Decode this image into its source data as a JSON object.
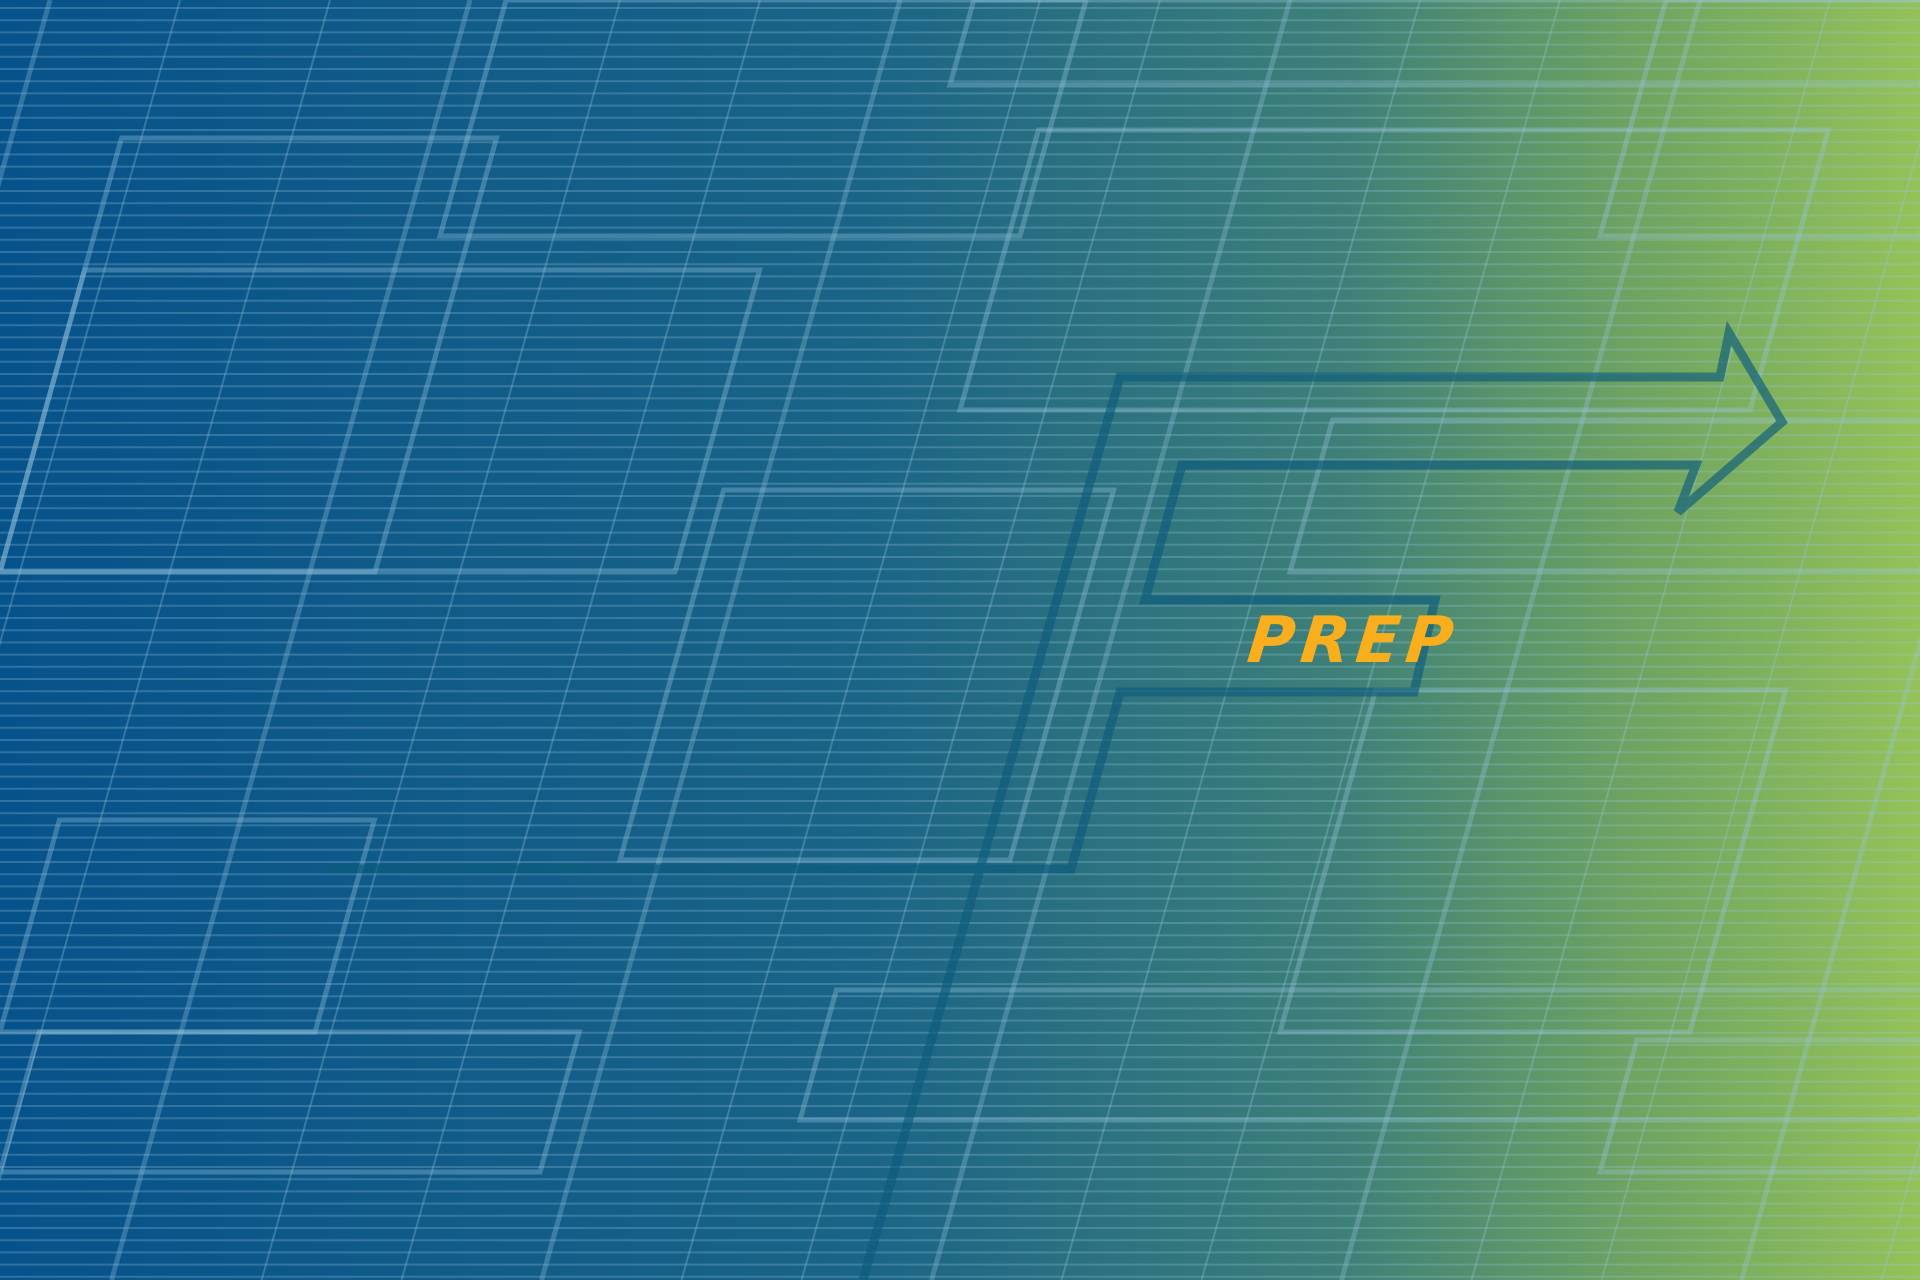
{
  "graphic": {
    "label": "PREP",
    "colors": {
      "gradient_start": "#06528a",
      "gradient_mid": "#1f6b86",
      "gradient_mid2": "#4a8a70",
      "gradient_end": "#94c258",
      "grid_line": "#7fb3d0",
      "arrow": "#0d5a7c",
      "label": "#f9ae1d"
    }
  }
}
